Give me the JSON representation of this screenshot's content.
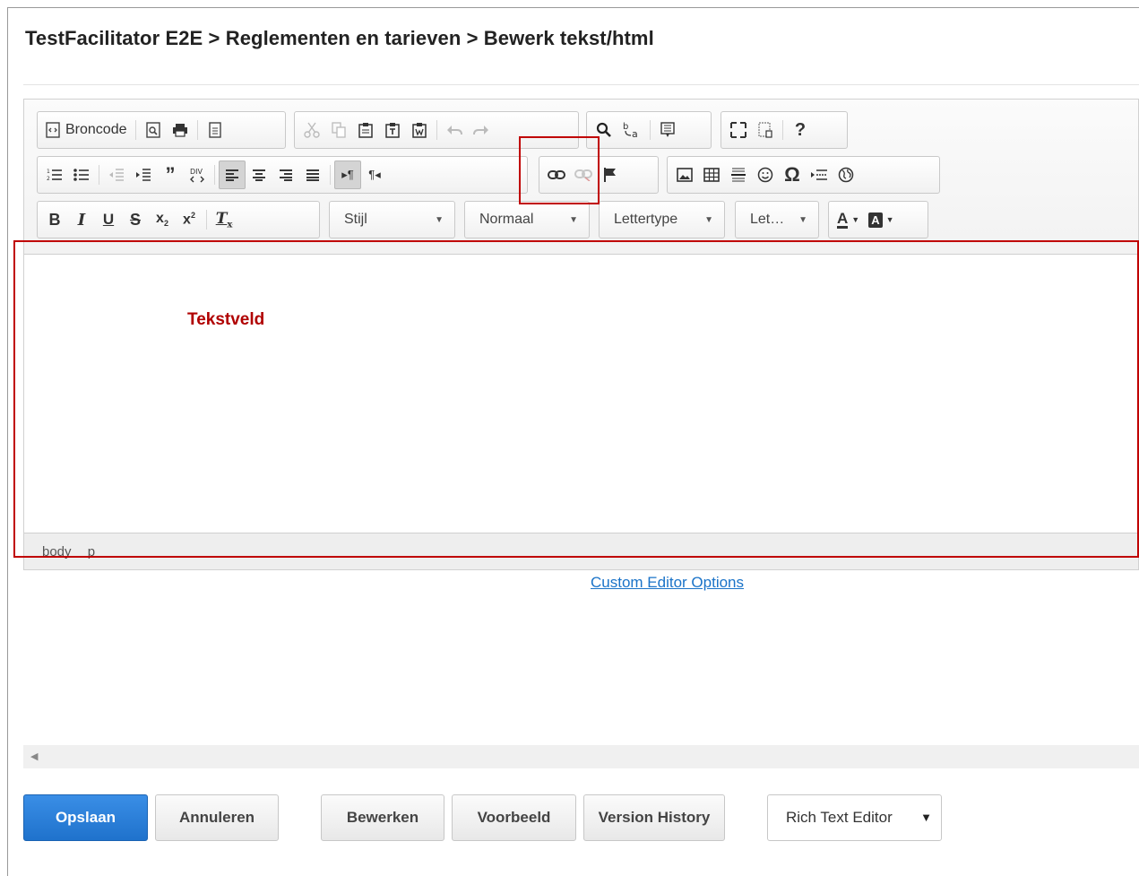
{
  "breadcrumb": {
    "title": "TestFacilitator E2E > Reglementen en tarieven > Bewerk tekst/html"
  },
  "toolbar": {
    "source_label": "Broncode",
    "style_combo": "Stijl",
    "format_combo": "Normaal",
    "font_combo": "Lettertype",
    "size_combo": "Let…",
    "div_label": "DIV",
    "help_label": "?"
  },
  "editor": {
    "annotation_label": "Tekstveld",
    "status_path": [
      "body",
      "p"
    ]
  },
  "links": {
    "custom_editor_options": "Custom Editor Options"
  },
  "buttons": {
    "save": "Opslaan",
    "cancel": "Annuleren",
    "edit": "Bewerken",
    "preview": "Voorbeeld",
    "version_history": "Version History"
  },
  "editor_mode_select": {
    "selected": "Rich Text Editor"
  },
  "colors": {
    "annotation_red": "#c00000",
    "primary_button": "#2a7fd8",
    "link_blue": "#1a73c8"
  }
}
